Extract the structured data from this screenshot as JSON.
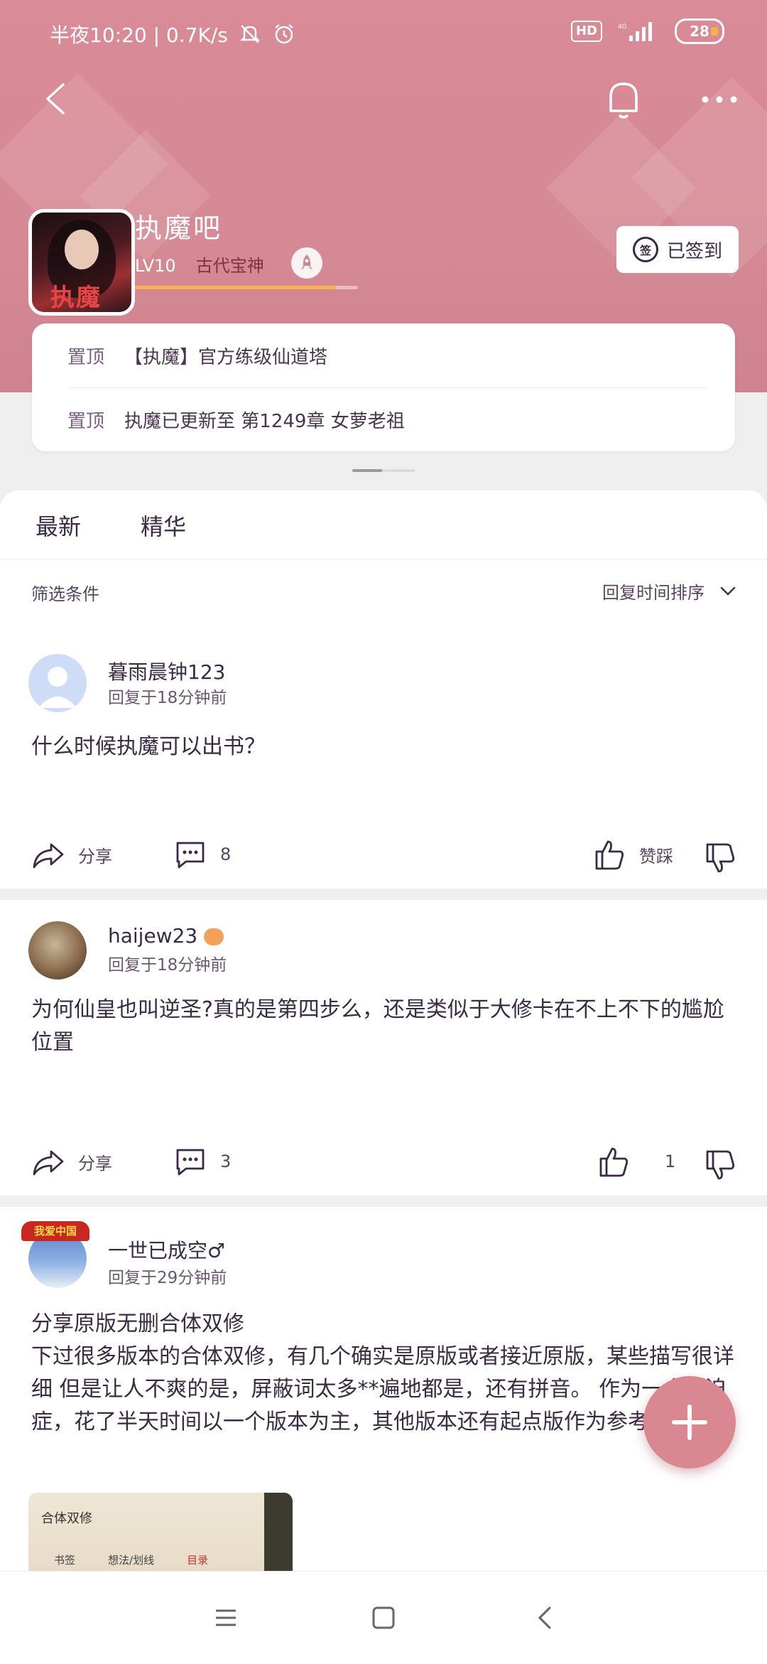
{
  "status_bar": {
    "time": "半夜10:20 | 0.7K/s",
    "hd": "HD",
    "battery": "28",
    "battery_level": 0.28,
    "icons": [
      "mute-icon",
      "alarm-icon",
      "hd-icon",
      "signal-icon",
      "battery-icon"
    ]
  },
  "nav": {
    "icons": [
      "back-icon",
      "bell-icon",
      "more-icon"
    ]
  },
  "forum": {
    "name": "执魔吧",
    "level": "LV10",
    "level_title": "古代宝神",
    "level_progress": 0.9,
    "checkin_label": "已签到",
    "checkin_icon_text": "签"
  },
  "pinned": [
    {
      "tag": "置顶",
      "text": "【执魔】官方练级仙道塔"
    },
    {
      "tag": "置顶",
      "text": "执魔已更新至 第1249章 女萝老祖"
    }
  ],
  "tabs": [
    {
      "label": "最新"
    },
    {
      "label": "精华"
    }
  ],
  "filter": {
    "label": "筛选条件",
    "sort_label": "回复时间排序"
  },
  "posts": [
    {
      "username": "暮雨晨钟123",
      "time": "回复于18分钟前",
      "body": "什么时候执魔可以出书？",
      "share_label": "分享",
      "comments": "8",
      "likes": "赞踩"
    },
    {
      "username": "haijew23",
      "time": "回复于18分钟前",
      "body": "为何仙皇也叫逆圣?真的是第四步么，还是类似于大修卡在不上不下的尴尬位置",
      "share_label": "分享",
      "comments": "3",
      "likes": "1"
    },
    {
      "username": "一世已成空♂",
      "avatar_badge": "我爱中国",
      "time": "回复于29分钟前",
      "title": "分享原版无删合体双修",
      "body": "下过很多版本的合体双修，有几个确实是原版或者接近原版，某些描写很详细 但是让人不爽的是，屏蔽词太多**遍地都是，还有拼音。 作为一个强迫症，花了半天时间以一个版本为主，其他版本还有起点版作为参考，...全文",
      "image": {
        "title": "合体双修",
        "tabs": [
          "书签",
          "想法/划线",
          "目录"
        ]
      }
    }
  ],
  "colors": {
    "header": "#d98b97",
    "accent": "#f7b14e",
    "fab": "#d98891"
  }
}
